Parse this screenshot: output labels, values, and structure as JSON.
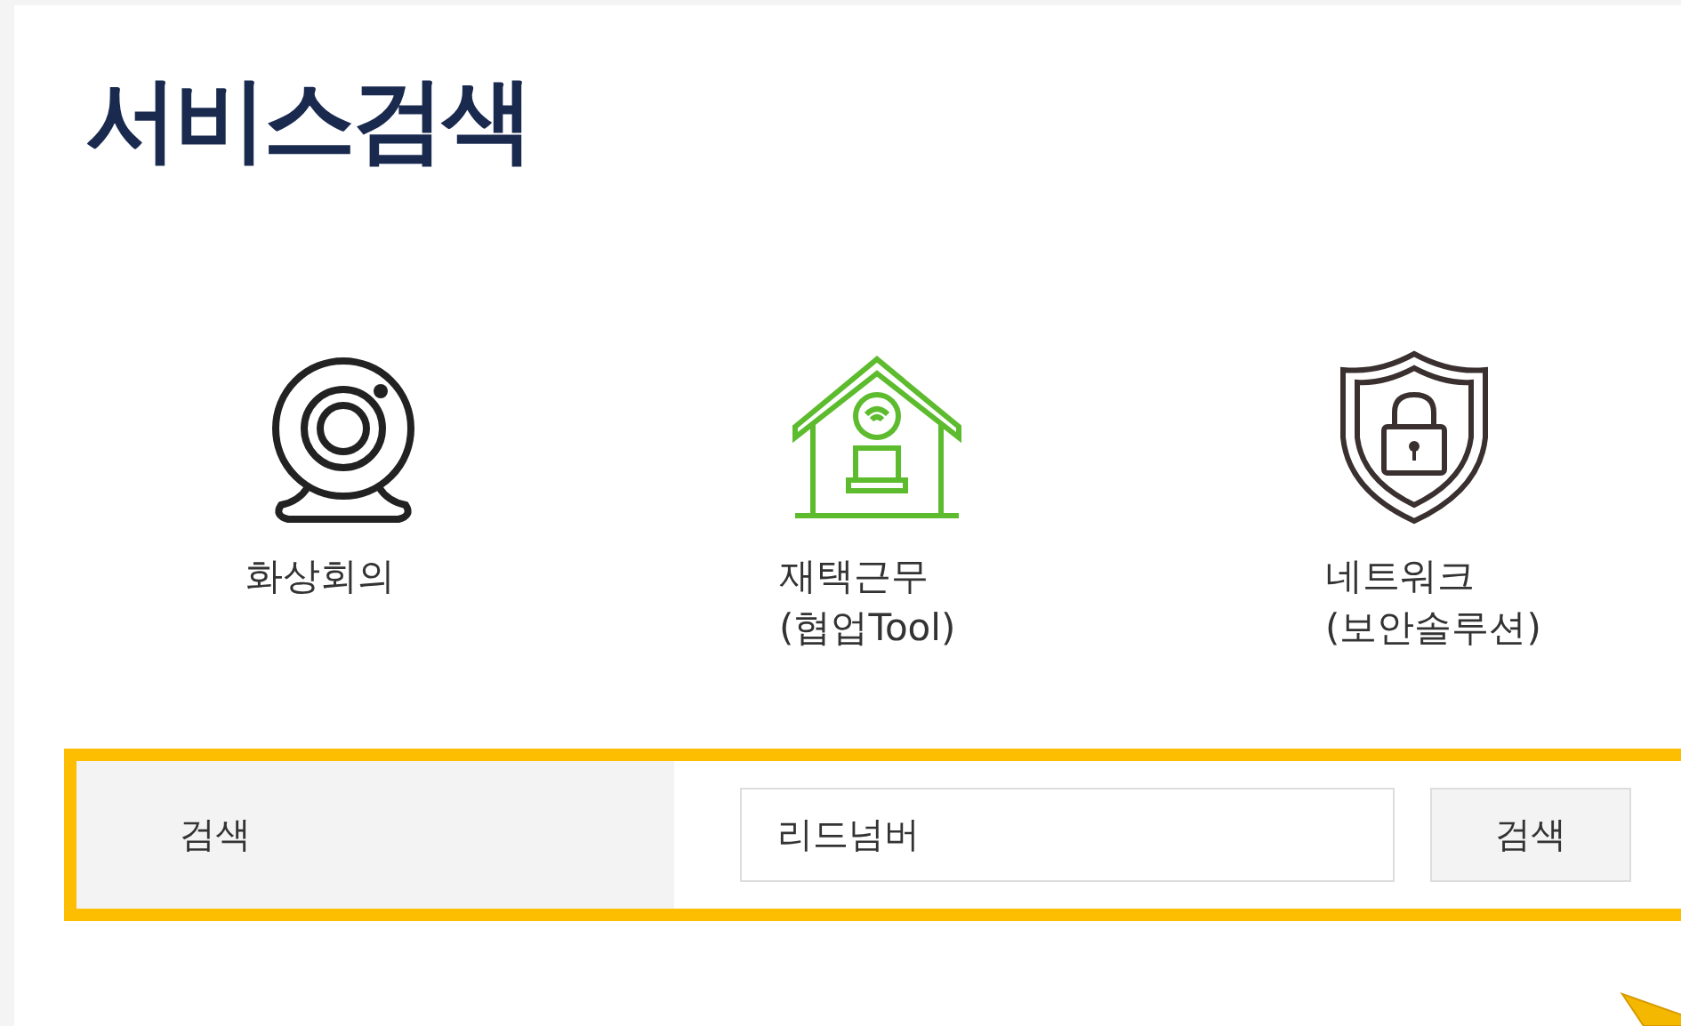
{
  "title": "서비스검색",
  "services": [
    {
      "kind": "webcam",
      "lines": [
        "화상회의"
      ]
    },
    {
      "kind": "home",
      "lines": [
        "재택근무",
        "(협업Tool)"
      ]
    },
    {
      "kind": "shield",
      "lines": [
        "네트워크",
        "(보안솔루션)"
      ]
    }
  ],
  "search": {
    "label": "검색",
    "value": "리드넘버",
    "button": "검색"
  }
}
